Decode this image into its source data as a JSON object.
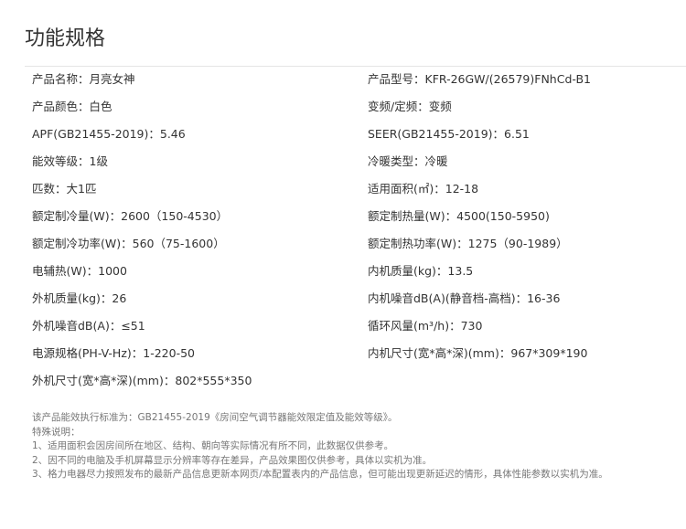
{
  "page": {
    "title": "功能规格"
  },
  "specs": [
    {
      "left": "产品名称：月亮女神",
      "right": "产品型号：KFR-26GW/(26579)FNhCd-B1"
    },
    {
      "left": "产品颜色：白色",
      "right": "变频/定频：变频"
    },
    {
      "left": "APF(GB21455-2019)：5.46",
      "right": "SEER(GB21455-2019)：6.51"
    },
    {
      "left": "能效等级：1级",
      "right": "冷暖类型：冷暖"
    },
    {
      "left": "匹数：大1匹",
      "right": "适用面积(㎡)：12-18"
    },
    {
      "left": "额定制冷量(W)：2600（150-4530）",
      "right": "额定制热量(W)：4500(150-5950)"
    },
    {
      "left": "额定制冷功率(W)：560（75-1600）",
      "right": "额定制热功率(W)：1275（90-1989）"
    },
    {
      "left": "电辅热(W)：1000",
      "right": "内机质量(kg)：13.5"
    },
    {
      "left": "外机质量(kg)：26",
      "right": "内机噪音dB(A)(静音档-高档)：16-36"
    },
    {
      "left": "外机噪音dB(A)：≤51",
      "right": "循环风量(m³/h)：730"
    },
    {
      "left": "电源规格(PH-V-Hz)：1-220-50",
      "right": "内机尺寸(宽*高*深)(mm)：967*309*190"
    },
    {
      "left": "外机尺寸(宽*高*深)(mm)：802*555*350",
      "right": ""
    }
  ],
  "notes": {
    "standard": "该产品能效执行标准为：GB21455-2019《房间空气调节器能效限定值及能效等级》。",
    "heading": "特殊说明：",
    "items": [
      "1、适用面积会因房间所在地区、结构、朝向等实际情况有所不同，此数据仅供参考。",
      "2、因不同的电脑及手机屏幕显示分辨率等存在差异，产品效果图仅供参考，具体以实机为准。",
      "3、格力电器尽力按照发布的最新产品信息更新本网页/本配置表内的产品信息，但可能出现更新延迟的情形，具体性能参数以实机为准。"
    ]
  }
}
